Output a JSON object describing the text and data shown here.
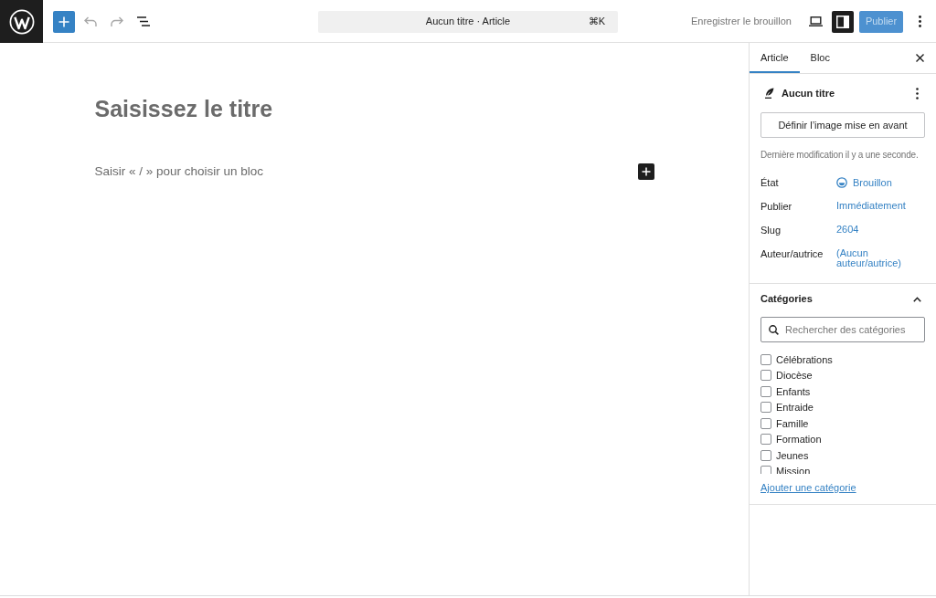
{
  "top_bar": {
    "undo": {
      "disabled": true
    },
    "redo": {
      "disabled": true
    },
    "command_bar": {
      "title": "Aucun titre · Article",
      "shortcut": "⌘K"
    },
    "save_draft": {
      "label": "Enregistrer le brouillon",
      "disabled": true
    },
    "settings_toggle": {
      "pressed": true
    },
    "publish": {
      "label": "Publier",
      "disabled": true
    }
  },
  "editor": {
    "title": {
      "placeholder": "Saisissez le titre"
    },
    "block": {
      "placeholder": "Saisir « / » pour choisir un bloc"
    }
  },
  "sidebar": {
    "tabs": [
      {
        "label": "Article",
        "selected": true
      },
      {
        "label": "Bloc",
        "selected": false
      }
    ],
    "summary": {
      "post_title": "Aucun titre",
      "featured_image_button": "Définir l’image mise en avant",
      "last_modified": "Dernière modification il y a une seconde.",
      "rows": [
        {
          "kind": "status",
          "label": "État",
          "value": "Brouillon"
        },
        {
          "kind": "link",
          "label": "Publier",
          "value": "Immédiatement"
        },
        {
          "kind": "link",
          "label": "Slug",
          "value": "2604"
        },
        {
          "kind": "link",
          "label": "Auteur/autrice",
          "value": "(Aucun auteur/autrice)"
        }
      ]
    },
    "categories": {
      "title": "Catégories",
      "expanded": true,
      "search": {
        "placeholder": "Rechercher des catégories"
      },
      "items": [
        {
          "label": "Célébrations",
          "checked": false
        },
        {
          "label": "Diocèse",
          "checked": false
        },
        {
          "label": "Enfants",
          "checked": false
        },
        {
          "label": "Entraide",
          "checked": false
        },
        {
          "label": "Famille",
          "checked": false
        },
        {
          "label": "Formation",
          "checked": false
        },
        {
          "label": "Jeunes",
          "checked": false
        },
        {
          "label": "Mission",
          "checked": false
        }
      ],
      "add_link": "Ajouter une catégorie"
    }
  }
}
